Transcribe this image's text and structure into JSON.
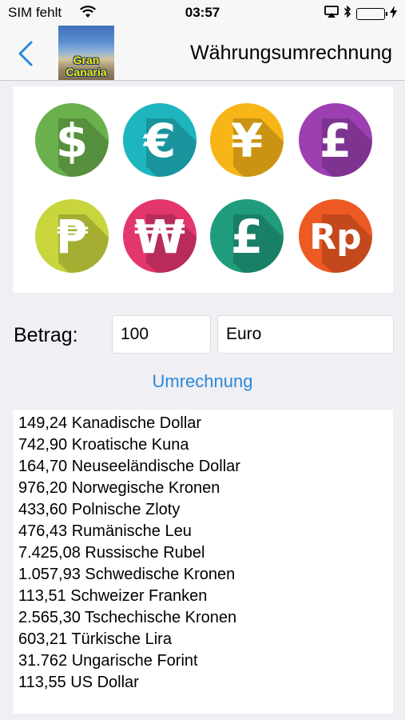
{
  "status_bar": {
    "carrier": "SIM fehlt",
    "time": "03:57",
    "battery_level": 1.0,
    "battery_color": "#4cd964"
  },
  "nav": {
    "back_icon": "chevron-left-icon",
    "logo_line1": "Gran",
    "logo_line2": "Canaria",
    "title": "Währungsumrechnung",
    "tint_color": "#2b88d9"
  },
  "currency_icons": [
    {
      "name": "dollar-icon",
      "symbol": "$",
      "color": "#6ab04c"
    },
    {
      "name": "euro-icon",
      "symbol": "€",
      "color": "#1fb5bf"
    },
    {
      "name": "yen-icon",
      "symbol": "¥",
      "color": "#f7b517"
    },
    {
      "name": "pound-icon",
      "symbol": "£",
      "color": "#9c3fb1"
    },
    {
      "name": "peso-icon",
      "symbol": "₱",
      "color": "#c8d53d"
    },
    {
      "name": "won-icon",
      "symbol": "₩",
      "color": "#e2366d"
    },
    {
      "name": "pound-icon",
      "symbol": "£",
      "color": "#1f9c7c"
    },
    {
      "name": "rupiah-icon",
      "symbol": "Rp",
      "color": "#ee5a24"
    }
  ],
  "form": {
    "amount_label": "Betrag:",
    "amount_value": "100",
    "currency_value": "Euro",
    "convert_button": "Umrechnung"
  },
  "results": [
    "149,24 Kanadische Dollar",
    "742,90 Kroatische Kuna",
    "164,70 Neuseeländische Dollar",
    "976,20 Norwegische Kronen",
    "433,60 Polnische Zloty",
    "476,43 Rumänische Leu",
    "7.425,08 Russische Rubel",
    "1.057,93 Schwedische Kronen",
    "113,51 Schweizer Franken",
    "2.565,30 Tschechische Kronen",
    "603,21 Türkische Lira",
    "31.762 Ungarische Forint",
    "113,55 US Dollar"
  ]
}
